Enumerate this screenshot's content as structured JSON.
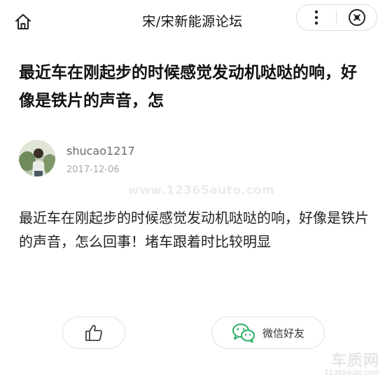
{
  "topbar": {
    "title": "宋/宋新能源论坛",
    "home_icon": "home-icon",
    "more_icon": "more-vertical-icon",
    "close_icon": "close-circle-icon"
  },
  "post": {
    "title": "最近车在刚起步的时候感觉发动机哒哒的响，好像是铁片的声音，怎",
    "author": {
      "name": "shucao1217",
      "date": "2017-12-06"
    },
    "body": "最近车在刚起步的时候感觉发动机哒哒的响，好像是铁片的声音，怎么回事！堵车跟着时比较明显"
  },
  "actions": {
    "like_icon": "thumbs-up-icon",
    "share_icon": "wechat-icon",
    "share_label": "微信好友"
  },
  "watermarks": {
    "middle": "www.12365auto.com",
    "logo_text": "车质网",
    "logo_url": "12365auto.com"
  },
  "colors": {
    "wechat_green": "#2aae67",
    "icon_dark": "#222222"
  }
}
